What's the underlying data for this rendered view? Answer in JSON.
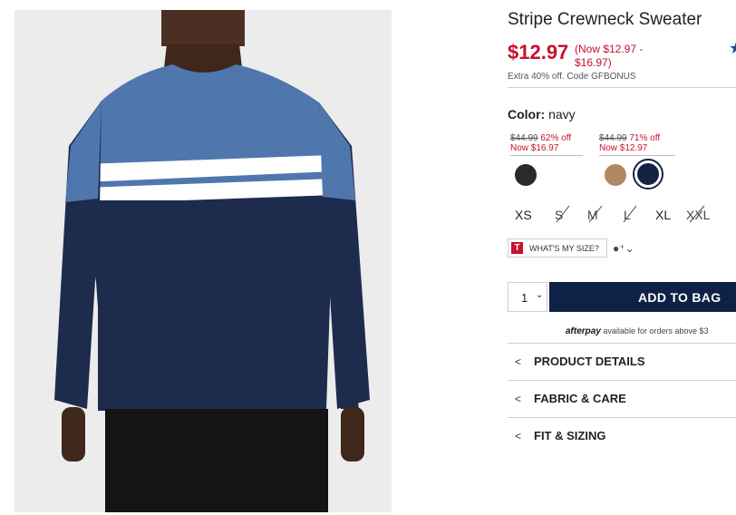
{
  "product": {
    "title": "Stripe Crewneck Sweater",
    "price": "$12.97",
    "price_range": "(Now $12.97 - $16.97)",
    "promo": "Extra 40% off. Code GFBONUS",
    "rating_icon": "star-icon"
  },
  "color": {
    "label": "Color:",
    "value": "navy",
    "groups": [
      {
        "was": "$44.99",
        "off": "62% off",
        "now": "Now $16.97"
      },
      {
        "was": "$44.99",
        "off": "71% off",
        "now": "Now $12.97"
      }
    ],
    "swatches": [
      {
        "name": "black",
        "hex": "#2a2a2a"
      },
      {
        "name": "tan",
        "hex": "#b08862"
      },
      {
        "name": "navy",
        "hex": "#142244",
        "selected": true
      }
    ]
  },
  "sizes": [
    {
      "label": "XS",
      "available": true
    },
    {
      "label": "S",
      "available": false
    },
    {
      "label": "M",
      "available": false
    },
    {
      "label": "L",
      "available": false
    },
    {
      "label": "XL",
      "available": true
    },
    {
      "label": "XXL",
      "available": false
    }
  ],
  "fit": {
    "icon_letter": "T",
    "label": "WHAT'S MY SIZE?"
  },
  "cart": {
    "quantity": "1",
    "add_label": "ADD TO BAG"
  },
  "afterpay": {
    "brand": "afterpay",
    "text": "available for orders above $3"
  },
  "accordion": [
    {
      "label": "PRODUCT DETAILS"
    },
    {
      "label": "FABRIC & CARE"
    },
    {
      "label": "FIT & SIZING"
    }
  ],
  "colors": {
    "sale_red": "#c8102e",
    "navy_button": "#0f2147",
    "sweater_blue": "#4f77ad",
    "sweater_navy": "#1d2c4d"
  }
}
